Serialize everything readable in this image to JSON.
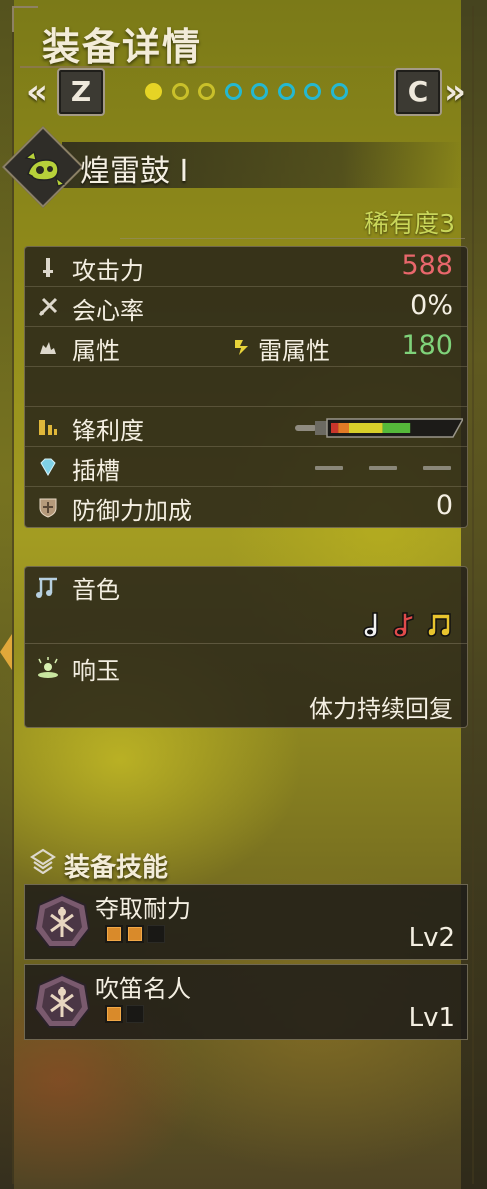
{
  "header": {
    "title": "装备详情",
    "prev_key": "Z",
    "next_key": "C",
    "prev_chevron": "«",
    "next_chevron": "»",
    "page_dots": {
      "total": 8,
      "active_index": 0,
      "yellow_count": 3
    }
  },
  "weapon": {
    "icon": "hunting-horn-icon",
    "name": "煌雷鼓 I",
    "rarity": "稀有度3"
  },
  "stats": {
    "attack_label": "攻击力",
    "attack_value": "588",
    "affinity_label": "会心率",
    "affinity_value": "0%",
    "element_label": "属性",
    "element_type": "雷属性",
    "element_value": "180",
    "sharpness_label": "锋利度",
    "sharpness": [
      {
        "color": "#c9362c",
        "fraction": 0.06
      },
      {
        "color": "#e27a26",
        "fraction": 0.09
      },
      {
        "color": "#d8cf2a",
        "fraction": 0.28
      },
      {
        "color": "#55b93a",
        "fraction": 0.23
      },
      {
        "color": "#2f86cf",
        "fraction": 0.0
      }
    ],
    "slots_label": "插槽",
    "slots": [
      "—",
      "—",
      "—"
    ],
    "defense_bonus_label": "防御力加成",
    "defense_bonus_value": "0"
  },
  "melody": {
    "notes_label": "音色",
    "notes": [
      {
        "icon": "white-note-icon",
        "color": "#f2f2f2"
      },
      {
        "icon": "red-note-icon",
        "color": "#e14b4b"
      },
      {
        "icon": "yellow-double-note-icon",
        "color": "#e8c42e"
      }
    ],
    "echo_label": "响玉",
    "echo_value": "体力持续回复"
  },
  "skills": {
    "header": "装备技能",
    "items": [
      {
        "name": "夺取耐力",
        "level": "Lv2",
        "filled": 2,
        "total": 3
      },
      {
        "name": "吹笛名人",
        "level": "Lv1",
        "filled": 1,
        "total": 2
      }
    ]
  },
  "colors": {
    "rarity": "#c9d659",
    "attack": "#e9676c",
    "element_value": "#7fd27a",
    "dot_active": "#e6d425",
    "dot_inactive": "#25b8d0"
  }
}
